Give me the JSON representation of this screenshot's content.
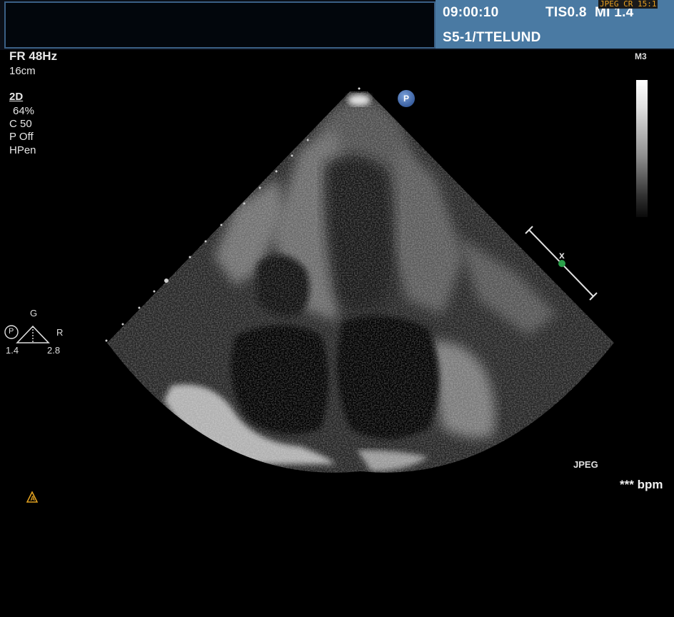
{
  "header": {
    "time": "09:00:10",
    "tis": "TIS0.8",
    "mi": "MI 1.4",
    "probe": "S5-1/TTELUND",
    "jpeg_cr": "JPEG CR 15:1"
  },
  "params": {
    "frame_rate": "FR 48Hz",
    "depth": "16cm",
    "mode": "2D",
    "gain": "64%",
    "compression": "C 50",
    "persistence": "P Off",
    "harmonic": "HPen"
  },
  "greyscale": {
    "map_label": "M3"
  },
  "orientation": {
    "g_label": "G",
    "r_label": "R",
    "p_label": "P",
    "left_value": "1.4",
    "right_value": "2.8"
  },
  "sector": {
    "p_marker": "P",
    "scale_marker": "x"
  },
  "footer": {
    "format": "JPEG",
    "heart_rate": "*** bpm"
  },
  "colors": {
    "header_panel": "#4a7aa3",
    "header_border": "#3a5f85",
    "jpeg_cr_text": "#e8a020",
    "warning_icon": "#e0a020",
    "marker_dot": "#2aa04a"
  }
}
